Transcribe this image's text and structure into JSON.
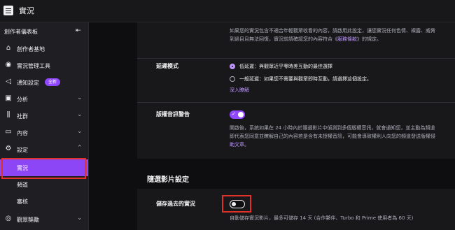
{
  "header": {
    "title": "實況"
  },
  "sidebar": {
    "title": "創作者儀表板",
    "items": [
      {
        "label": "創作者基地"
      },
      {
        "label": "實況管理工具"
      },
      {
        "label": "通知設定",
        "badge": "全新"
      },
      {
        "label": "分析"
      },
      {
        "label": "社群"
      },
      {
        "label": "內容"
      },
      {
        "label": "設定"
      },
      {
        "label": "實況"
      },
      {
        "label": "頻道"
      },
      {
        "label": "審核"
      },
      {
        "label": "觀眾獎勵"
      }
    ]
  },
  "settings": {
    "top_desc_line1": "如果您的實況包含不適合年輕觀眾收看的內容，請啟用此設定，讓您實況任何色情、裸露、威脅",
    "top_desc_line2_pre": "到過目且無法回復，實況前請確認您的內容符合《",
    "top_desc_link": "服務條款",
    "top_desc_line2_post": "》的規定。",
    "latency": {
      "label": "延遲模式",
      "options": [
        {
          "text": "低延遲：與觀眾近乎零時差互動的最佳選擇",
          "selected": true
        },
        {
          "text": "一般延遲：如果您不需要與觀眾即時互動，請選擇這個設定。",
          "selected": false
        }
      ],
      "learn_more": "深入瞭解"
    },
    "copyright": {
      "label": "版權音訊警告",
      "enabled": true,
      "desc_line1": "開啟後，系統如果在 24 小時內於隨選影片中偵測到多個版權音訊，就會通知您，並主動為頻道",
      "desc_line2": "即代表您同意並瞭解自己的內容若是含有未授權音訊，可能會導致權利人向您的頻道發送版權侵",
      "desc_line3": "助文章。"
    }
  },
  "vod": {
    "section_title": "隨選影片設定",
    "save_past": {
      "label": "儲存過去的實況",
      "enabled": false,
      "desc": "自動儲存實況影片，最多可儲存 14 天 (合作夥伴、Turbo 和 Prime 使用者為 60 天)"
    }
  },
  "colors": {
    "accent": "#9147ff",
    "highlight": "#e0312b",
    "link": "#bf94ff"
  }
}
